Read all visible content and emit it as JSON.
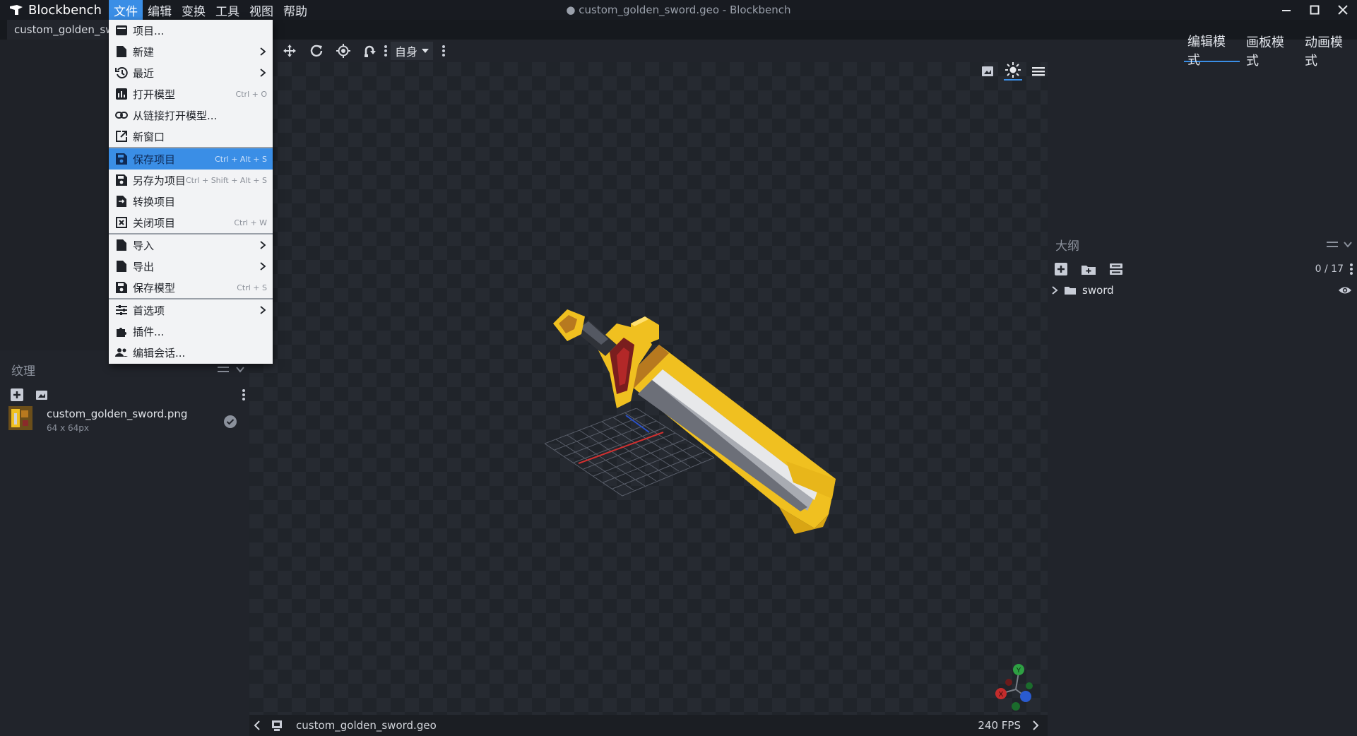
{
  "app": {
    "name": "Blockbench"
  },
  "window": {
    "title": "● custom_golden_sword.geo - Blockbench"
  },
  "menubar": [
    "文件",
    "编辑",
    "变换",
    "工具",
    "视图",
    "帮助"
  ],
  "tab": {
    "label": "custom_golden_sword.geo"
  },
  "toolbar": {
    "space_label": "自身"
  },
  "modes": [
    "编辑模式",
    "画板模式",
    "动画模式"
  ],
  "file_menu": {
    "items": [
      {
        "label": "项目...",
        "icon": "project-icon",
        "shortcut": "",
        "submenu": false
      },
      {
        "label": "新建",
        "icon": "new-file-icon",
        "shortcut": "",
        "submenu": true
      },
      {
        "label": "最近",
        "icon": "history-icon",
        "shortcut": "",
        "submenu": true
      },
      {
        "label": "打开模型",
        "icon": "open-model-icon",
        "shortcut": "Ctrl + O",
        "submenu": false
      },
      {
        "label": "从链接打开模型...",
        "icon": "link-icon",
        "shortcut": "",
        "submenu": false
      },
      {
        "label": "新窗口",
        "icon": "new-window-icon",
        "shortcut": "",
        "submenu": false
      },
      {
        "label": "保存项目",
        "icon": "save-icon",
        "shortcut": "Ctrl + Alt + S",
        "submenu": false,
        "highlighted": true
      },
      {
        "label": "另存为项目",
        "icon": "save-as-icon",
        "shortcut": "Ctrl + Shift + Alt + S",
        "submenu": false
      },
      {
        "label": "转换项目",
        "icon": "convert-icon",
        "shortcut": "",
        "submenu": false
      },
      {
        "label": "关闭项目",
        "icon": "close-box-icon",
        "shortcut": "Ctrl + W",
        "submenu": false
      },
      {
        "label": "导入",
        "icon": "import-icon",
        "shortcut": "",
        "submenu": true
      },
      {
        "label": "导出",
        "icon": "export-icon",
        "shortcut": "",
        "submenu": true
      },
      {
        "label": "保存模型",
        "icon": "save-model-icon",
        "shortcut": "Ctrl + S",
        "submenu": false
      },
      {
        "label": "首选项",
        "icon": "preferences-icon",
        "shortcut": "",
        "submenu": true
      },
      {
        "label": "插件...",
        "icon": "plugin-icon",
        "shortcut": "",
        "submenu": false
      },
      {
        "label": "编辑会话...",
        "icon": "session-icon",
        "shortcut": "",
        "submenu": false
      }
    ]
  },
  "textures": {
    "title": "纹理",
    "items": [
      {
        "name": "custom_golden_sword.png",
        "size": "64 x 64px"
      }
    ]
  },
  "outliner": {
    "title": "大纲",
    "count": "0 / 17",
    "items": [
      {
        "name": "sword"
      }
    ]
  },
  "status": {
    "file": "custom_golden_sword.geo",
    "fps": "240 FPS"
  },
  "gizmo": {
    "x": "X",
    "y": "Y"
  },
  "colors": {
    "accent": "#3a8ee6",
    "gold": "#f0c020",
    "bg": "#1e2127"
  }
}
